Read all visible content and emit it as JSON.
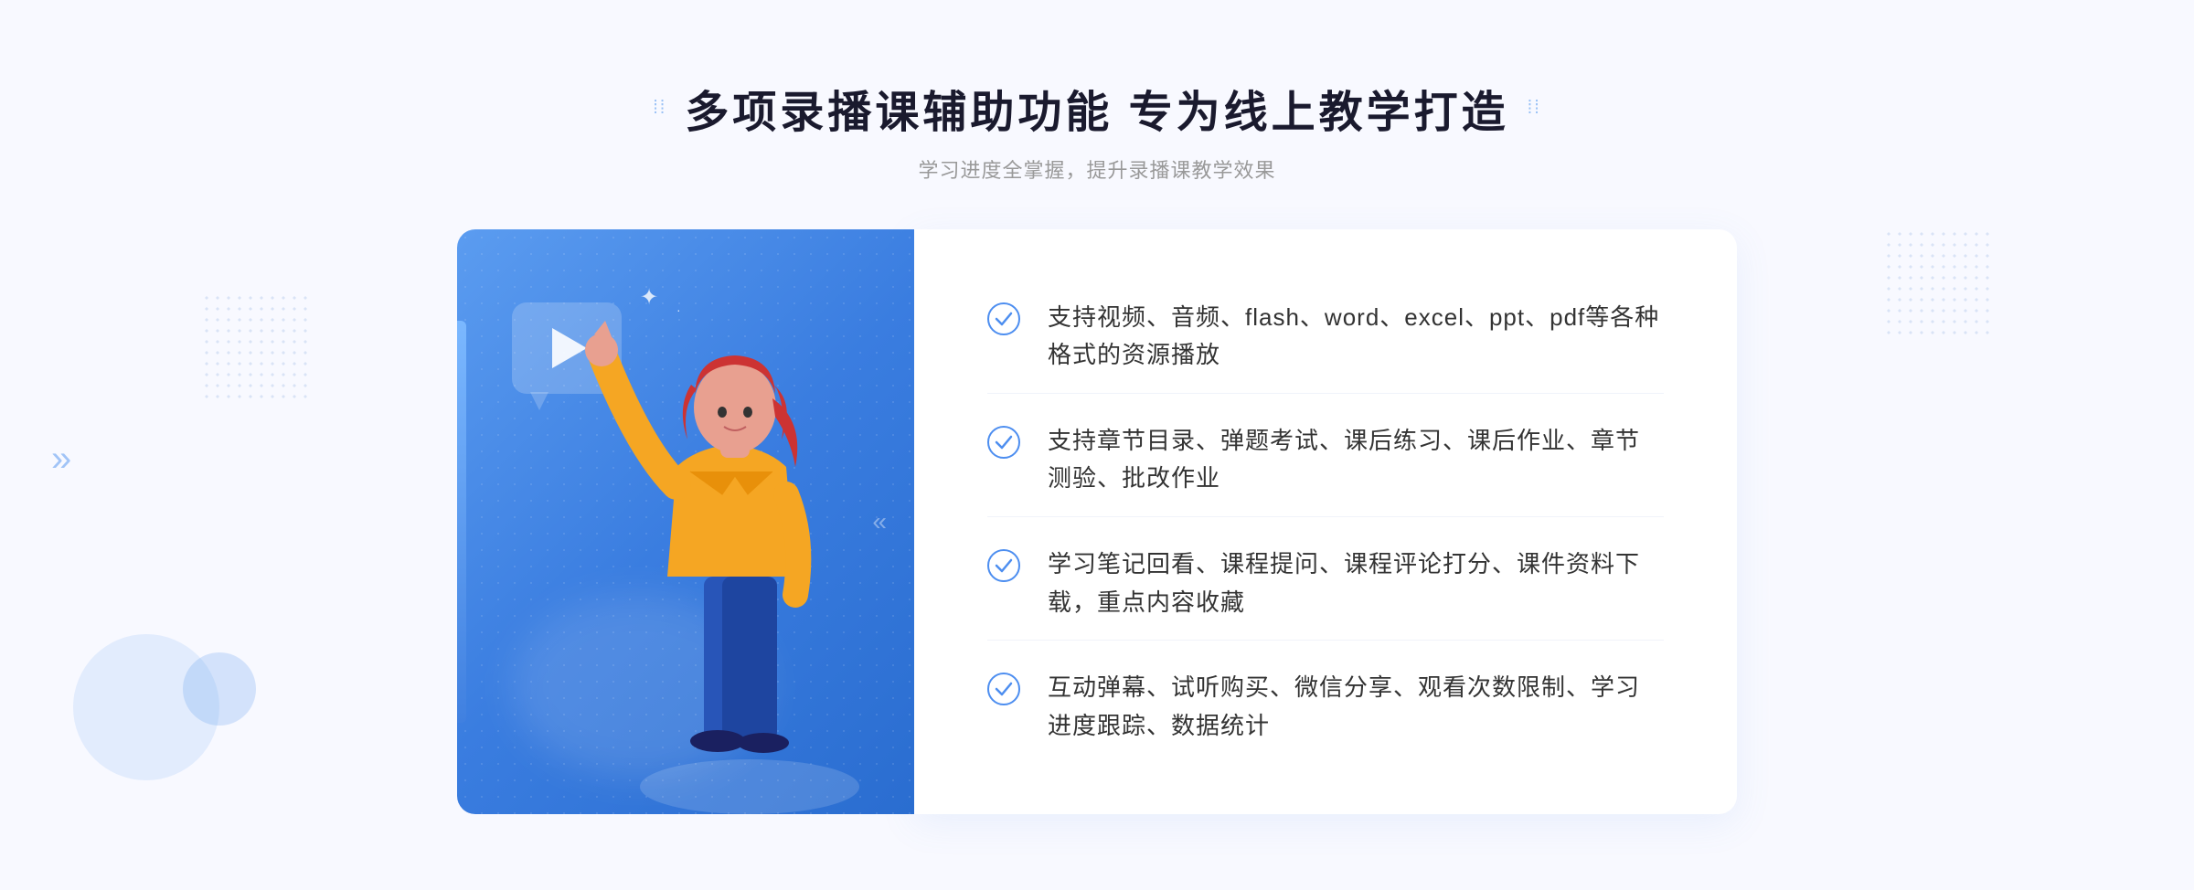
{
  "header": {
    "title": "多项录播课辅助功能 专为线上教学打造",
    "subtitle": "学习进度全掌握，提升录播课教学效果",
    "dot_icon_left": "⠿",
    "dot_icon_right": "⠿"
  },
  "features": [
    {
      "id": 1,
      "text": "支持视频、音频、flash、word、excel、ppt、pdf等各种格式的资源播放"
    },
    {
      "id": 2,
      "text": "支持章节目录、弹题考试、课后练习、课后作业、章节测验、批改作业"
    },
    {
      "id": 3,
      "text": "学习笔记回看、课程提问、课程评论打分、课件资料下载，重点内容收藏"
    },
    {
      "id": 4,
      "text": "互动弹幕、试听购买、微信分享、观看次数限制、学习进度跟踪、数据统计"
    }
  ],
  "colors": {
    "primary_blue": "#4d8ef0",
    "light_blue": "#6aaaf5",
    "dark_blue": "#2a6dd0",
    "text_dark": "#1a1a2e",
    "text_gray": "#999999",
    "text_body": "#333333",
    "bg_page": "#f8f9ff",
    "bg_white": "#ffffff"
  },
  "decorations": {
    "arrows_left": "»",
    "arrows_right": "»"
  }
}
